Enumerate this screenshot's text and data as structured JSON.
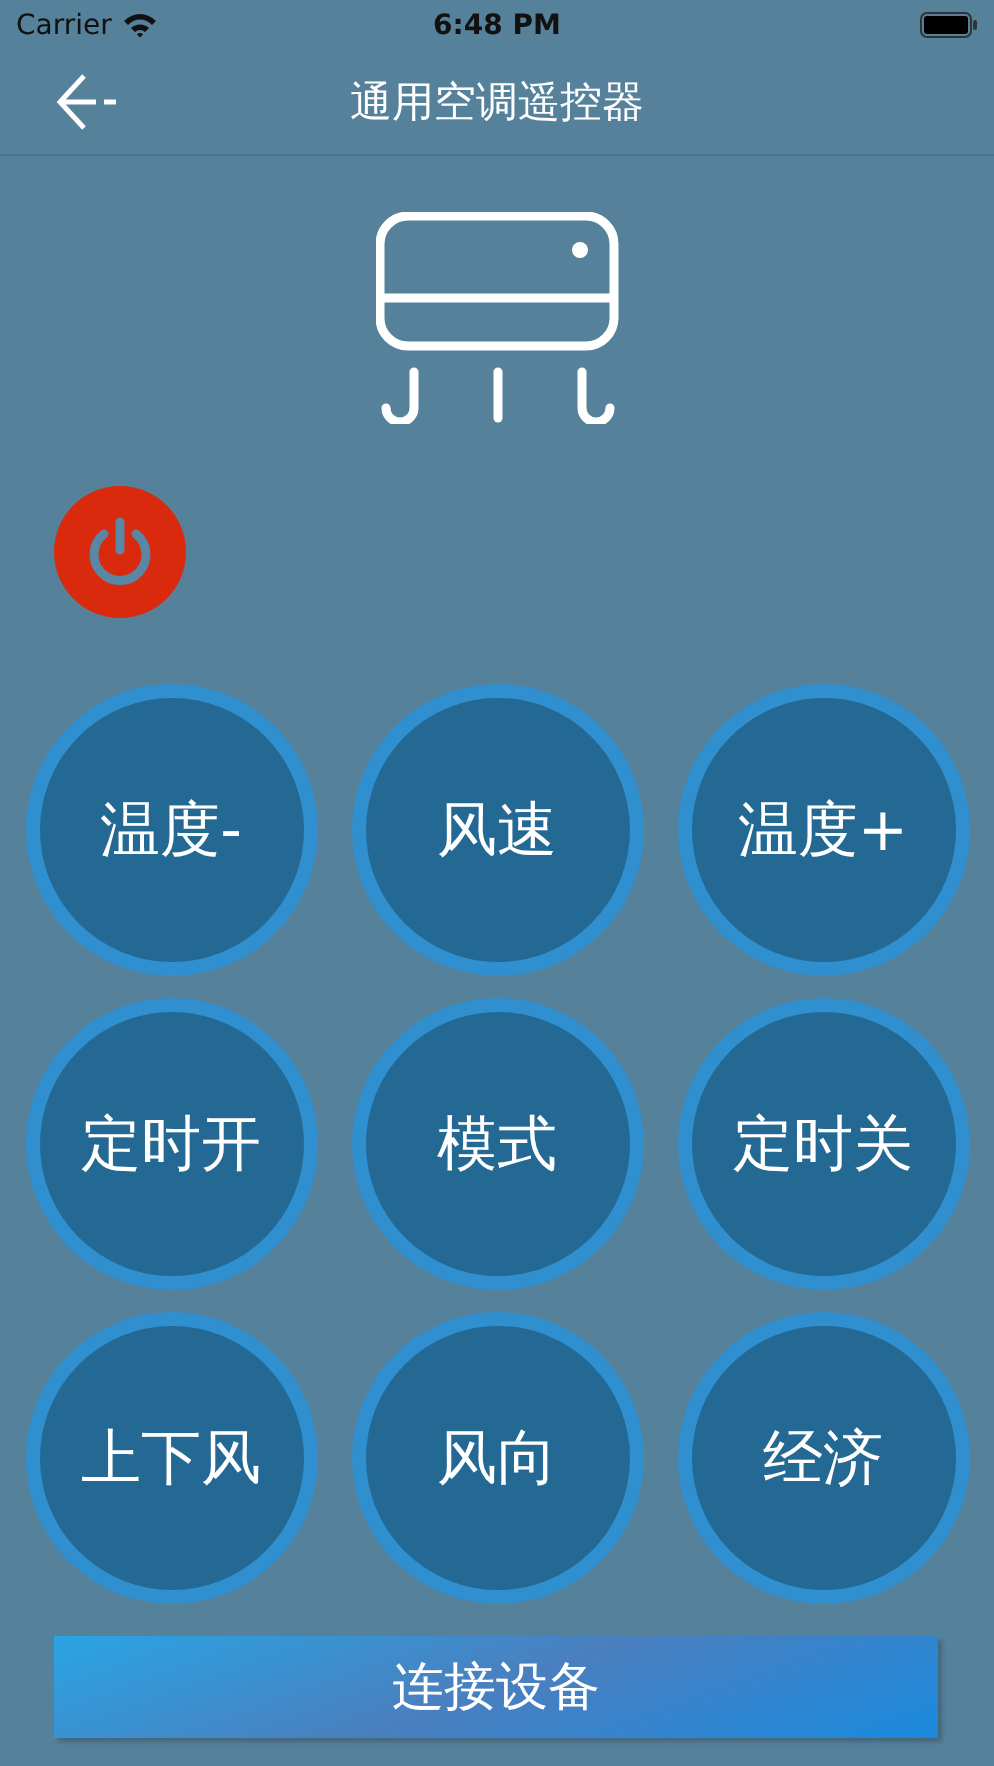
{
  "status_bar": {
    "carrier": "Carrier",
    "time": "6:48 PM"
  },
  "nav": {
    "title": "通用空调遥控器"
  },
  "buttons": [
    {
      "label": "温度-"
    },
    {
      "label": "风速"
    },
    {
      "label": "温度+"
    },
    {
      "label": "定时开"
    },
    {
      "label": "模式"
    },
    {
      "label": "定时关"
    },
    {
      "label": "上下风"
    },
    {
      "label": "风向"
    },
    {
      "label": "经济"
    }
  ],
  "connect_button": {
    "label": "连接设备"
  }
}
